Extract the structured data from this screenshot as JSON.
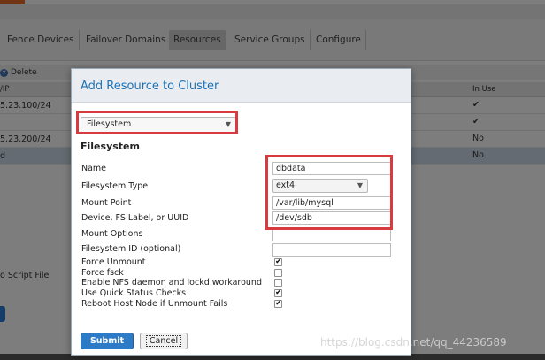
{
  "nav": {
    "tabs": [
      {
        "label": "Fence Devices"
      },
      {
        "label": "Failover Domains"
      },
      {
        "label": "Resources",
        "active": true
      },
      {
        "label": "Service Groups"
      },
      {
        "label": "Configure"
      }
    ]
  },
  "actions": {
    "delete_label": "Delete"
  },
  "grid": {
    "headers": {
      "ip": "/IP",
      "in_use": "In Use"
    },
    "rows": [
      {
        "ip": "5.23.100/24",
        "in_use": "✔"
      },
      {
        "ip": "",
        "in_use": "✔"
      },
      {
        "ip": "5.23.200/24",
        "in_use": "No"
      },
      {
        "ip": "d",
        "in_use": "No",
        "selected": true
      }
    ]
  },
  "background": {
    "script_label": "o Script File"
  },
  "dialog": {
    "title": "Add Resource to Cluster",
    "resource_type": "Filesystem",
    "section_title": "Filesystem",
    "fields": {
      "name": {
        "label": "Name",
        "value": "dbdata"
      },
      "fs_type": {
        "label": "Filesystem Type",
        "value": "ext4"
      },
      "mount_point": {
        "label": "Mount Point",
        "value": "/var/lib/mysql"
      },
      "device": {
        "label": "Device, FS Label, or UUID",
        "value": "/dev/sdb"
      },
      "mount_options": {
        "label": "Mount Options",
        "value": ""
      },
      "fs_id": {
        "label": "Filesystem ID (optional)",
        "value": ""
      }
    },
    "checkboxes": [
      {
        "label": "Force Unmount",
        "checked": true
      },
      {
        "label": "Force fsck",
        "checked": false
      },
      {
        "label": "Enable NFS daemon and lockd workaround",
        "checked": false
      },
      {
        "label": "Use Quick Status Checks",
        "checked": true
      },
      {
        "label": "Reboot Host Node if Unmount Fails",
        "checked": true
      }
    ],
    "submit_label": "Submit",
    "cancel_label": "Cancel"
  },
  "watermark": "https://blog.csdn.net/qq_44236589",
  "colors": {
    "title_blue": "#1a72b8",
    "submit_blue": "#2d7bc7",
    "annotation_red": "#d73a3f",
    "accent_orange": "#e26b2b"
  }
}
